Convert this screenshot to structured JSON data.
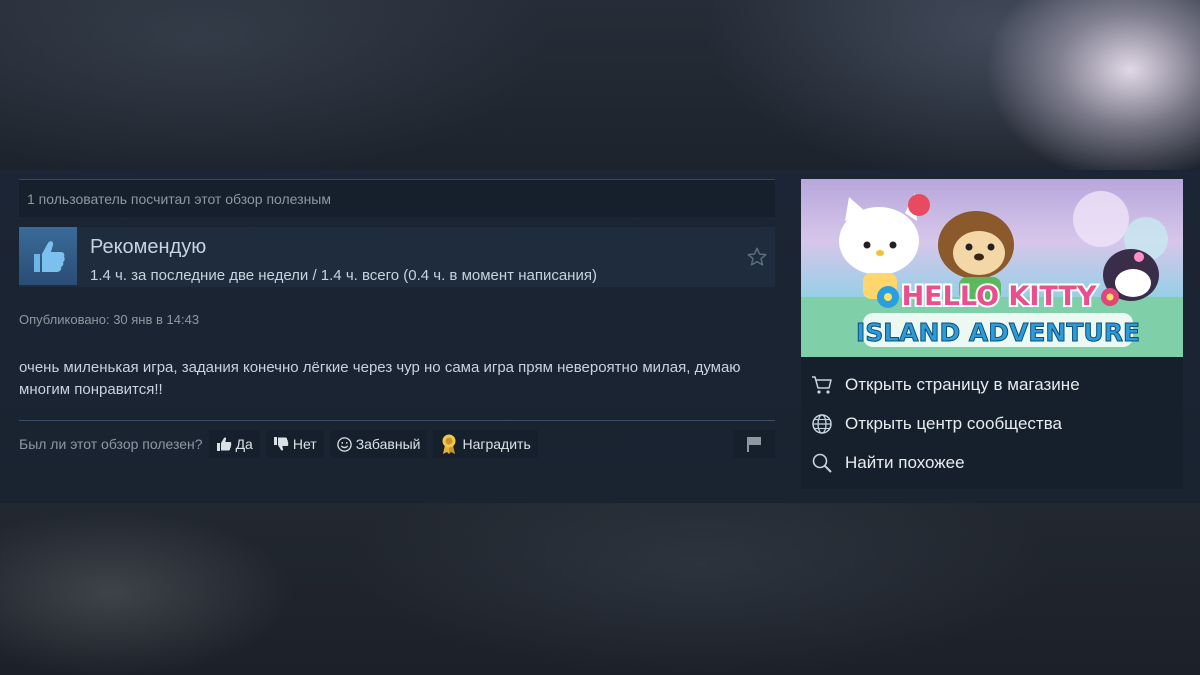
{
  "review": {
    "helpful_count_text": "1 пользователь посчитал этот обзор полезным",
    "verdict": "Рекомендую",
    "hours": "1.4 ч. за последние две недели / 1.4 ч. всего (0.4 ч. в момент написания)",
    "published": "Опубликовано: 30 янв в 14:43",
    "text": "очень миленькая игра, задания конечно лёгкие через чур но сама игра прям невероятно милая, думаю многим понравится!!"
  },
  "voting": {
    "question": "Был ли этот обзор полезен?",
    "yes_label": "Да",
    "no_label": "Нет",
    "funny_label": "Забавный",
    "award_label": "Наградить"
  },
  "game": {
    "logo_line1": "HELLO KITTY",
    "logo_line2": "ISLAND ADVENTURE"
  },
  "sidebar": {
    "links": [
      {
        "icon": "cart-icon",
        "label": "Открыть страницу в магазине"
      },
      {
        "icon": "globe-icon",
        "label": "Открыть центр сообщества"
      },
      {
        "icon": "search-icon",
        "label": "Найти похожее"
      }
    ]
  },
  "colors": {
    "panel_bg": "#1b2838",
    "accent_blue": "#3a6b98",
    "text_main": "#c6d4df",
    "text_muted": "#8f98a0",
    "award_gold": "#e5b53a"
  }
}
